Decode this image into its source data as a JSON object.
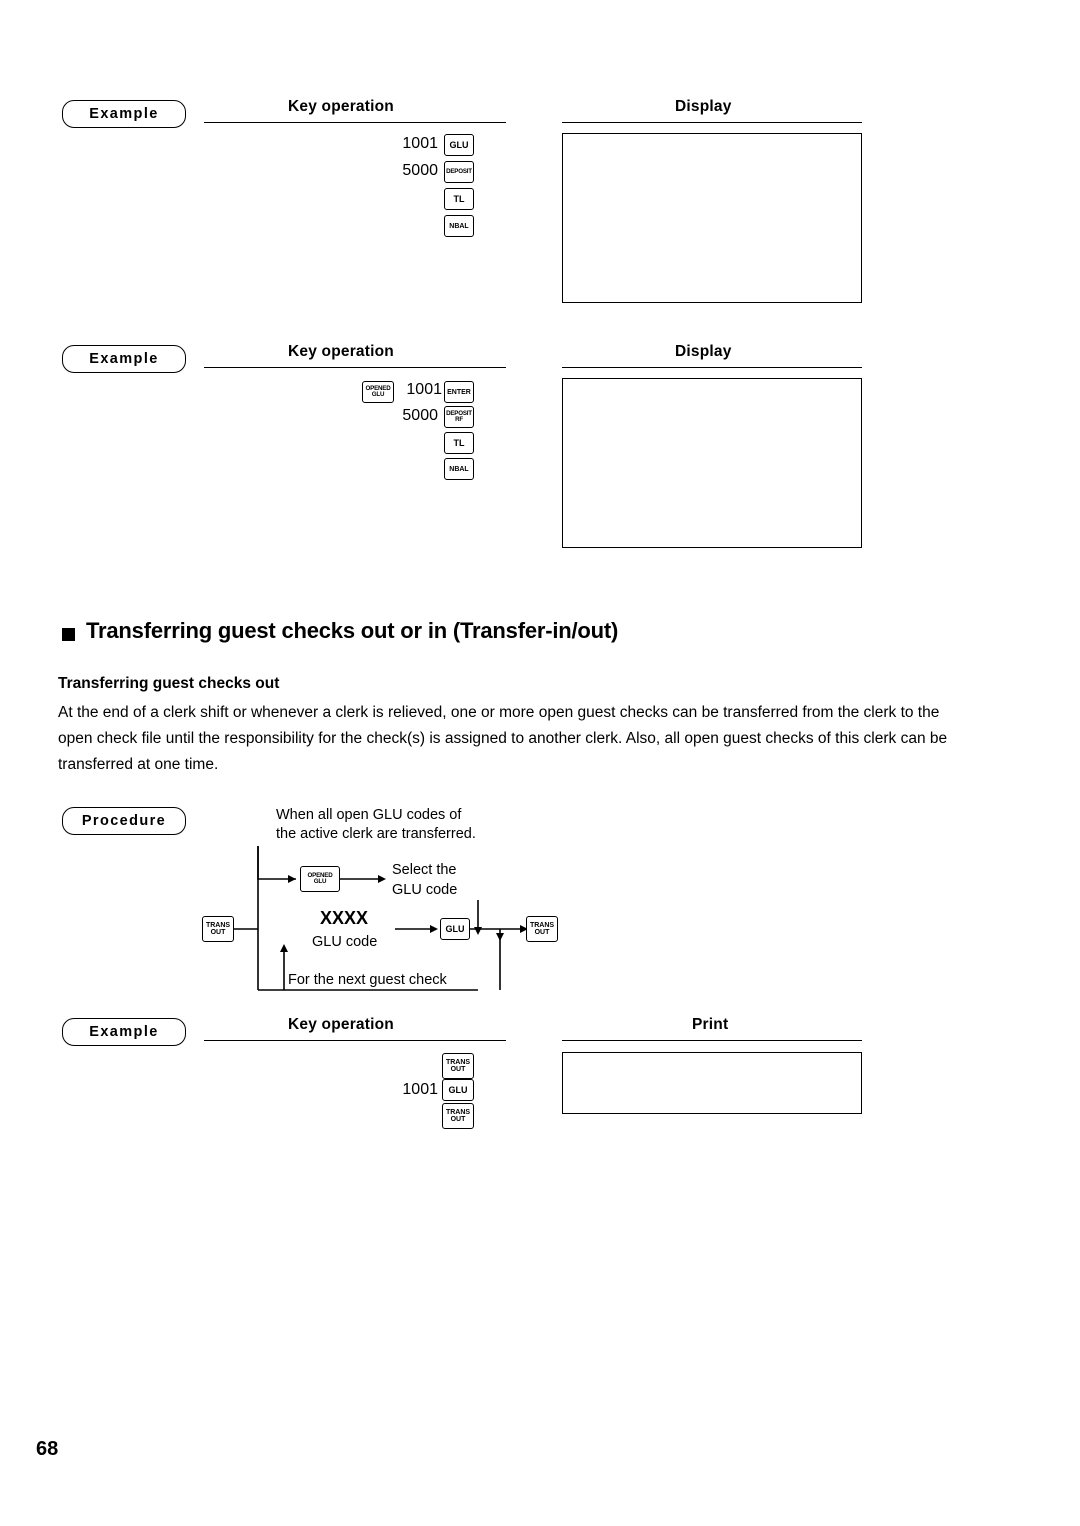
{
  "page": {
    "number": "68"
  },
  "labels": {
    "example": "Example",
    "procedure": "Procedure",
    "key_operation": "Key operation",
    "display": "Display",
    "print": "Print"
  },
  "block1": {
    "rows": [
      {
        "num": "1001",
        "key": {
          "l1": "GLU",
          "l2": ""
        }
      },
      {
        "num": "5000",
        "key": {
          "l1": "DEPOSIT",
          "l2": ""
        }
      },
      {
        "num": "",
        "key": {
          "l1": "TL",
          "l2": ""
        }
      },
      {
        "num": "",
        "key": {
          "l1": "NBAL",
          "l2": ""
        }
      }
    ]
  },
  "block2": {
    "rows": [
      {
        "prekey": {
          "l1": "OPENED",
          "l2": "GLU"
        },
        "num": "1001",
        "key": {
          "l1": "ENTER",
          "l2": ""
        }
      },
      {
        "prekey": null,
        "num": "5000",
        "key": {
          "l1": "DEPOSIT",
          "l2": "RF"
        }
      },
      {
        "prekey": null,
        "num": "",
        "key": {
          "l1": "TL",
          "l2": ""
        }
      },
      {
        "prekey": null,
        "num": "",
        "key": {
          "l1": "NBAL",
          "l2": ""
        }
      }
    ]
  },
  "section": {
    "title": "Transferring guest checks out or in (Transfer-in/out)",
    "subtitle": "Transferring guest checks out",
    "paragraph": "At the end of a clerk shift or whenever a clerk is relieved, one or more open guest checks can be transferred from the clerk to the open check file until the responsibility for the check(s) is assigned to another clerk.  Also, all open guest checks of this clerk can be transferred at one time."
  },
  "procedure": {
    "caption_line1": "When all open GLU codes of",
    "caption_line2": "the active clerk are transferred.",
    "select_line1": "Select the",
    "select_line2": "GLU code",
    "xxxx": "XXXX",
    "glu_code": "GLU code",
    "next_check": "For the next guest check",
    "keys": {
      "trans_out_left": {
        "l1": "TRANS",
        "l2": "OUT"
      },
      "opened_glu": {
        "l1": "OPENED",
        "l2": "GLU"
      },
      "glu": {
        "l1": "GLU",
        "l2": ""
      },
      "trans_out_right": {
        "l1": "TRANS",
        "l2": "OUT"
      },
      "trans_out_mid": {
        "l1": "TRANS",
        "l2": "OUT"
      }
    }
  },
  "block3": {
    "rows": [
      {
        "num": "",
        "key": {
          "l1": "TRANS",
          "l2": "OUT"
        }
      },
      {
        "num": "1001",
        "key": {
          "l1": "GLU",
          "l2": ""
        }
      },
      {
        "num": "",
        "key": {
          "l1": "TRANS",
          "l2": "OUT"
        }
      }
    ]
  }
}
